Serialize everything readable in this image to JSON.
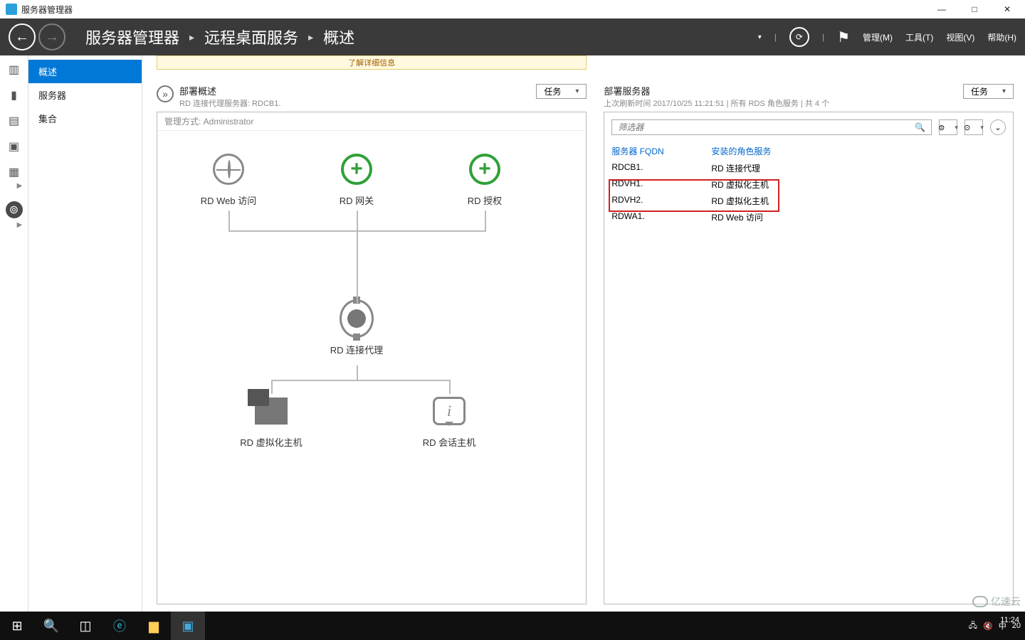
{
  "window": {
    "title": "服务器管理器",
    "minimize": "—",
    "maximize": "□",
    "close": "✕"
  },
  "breadcrumb": {
    "root": "服务器管理器",
    "section": "远程桌面服务",
    "page": "概述",
    "sep": "▸"
  },
  "header_menu": {
    "manage": "管理(M)",
    "tools": "工具(T)",
    "view": "视图(V)",
    "help": "帮助(H)"
  },
  "leftnav": {
    "overview": "概述",
    "servers": "服务器",
    "collections": "集合"
  },
  "notice_text": "了解详细信息",
  "overview_panel": {
    "title": "部署概述",
    "subtitle": "RD 连接代理服务器: RDCB1.",
    "tasks": "任务",
    "managed_by": "管理方式:          Administrator",
    "nodes": {
      "web": "RD Web 访问",
      "gateway": "RD 网关",
      "licensing": "RD 授权",
      "broker": "RD 连接代理",
      "vh": "RD 虚拟化主机",
      "sh": "RD 会话主机"
    }
  },
  "servers_panel": {
    "title": "部署服务器",
    "subtitle": "上次刷新时间 2017/10/25 11:21:51 | 所有 RDS 角色服务  | 共 4 个",
    "tasks": "任务",
    "filter_placeholder": "筛选器",
    "col_fqdn": "服务器 FQDN",
    "col_role": "安装的角色服务",
    "rows": [
      {
        "fqdn": "RDCB1.",
        "role": "RD 连接代理"
      },
      {
        "fqdn": "RDVH1.",
        "role": "RD 虚拟化主机"
      },
      {
        "fqdn": "RDVH2.",
        "role": "RD 虚拟化主机"
      },
      {
        "fqdn": "RDWA1.",
        "role": "RD Web 访问"
      }
    ]
  },
  "taskbar": {
    "clock": "11:24",
    "date_prefix": "20",
    "ime": "中"
  },
  "watermark": "亿速云"
}
